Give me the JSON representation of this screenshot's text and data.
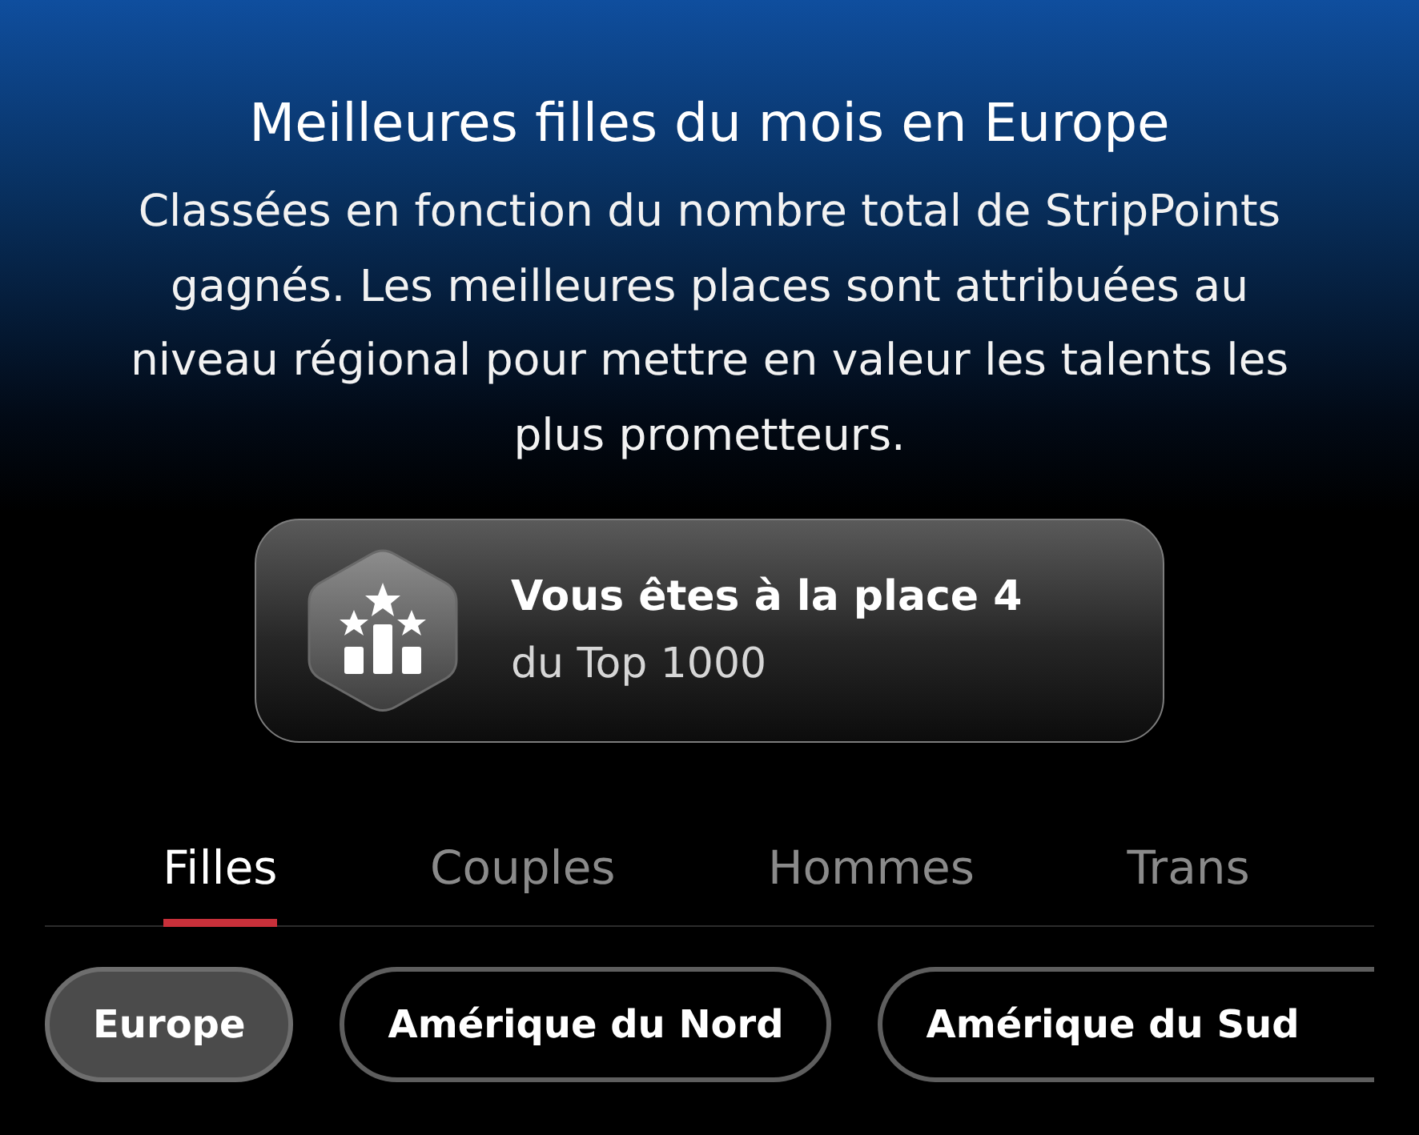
{
  "header": {
    "title": "Meilleures filles du mois en Europe",
    "description": "Classées en fonction du nombre total de StripPoints gagnés. Les meilleures places sont attribuées au niveau régional pour mettre en valeur les talents les plus prometteurs."
  },
  "rank_card": {
    "title": "Vous êtes à la place 4",
    "subtitle": "du Top 1000"
  },
  "tabs": [
    {
      "label": "Filles",
      "selected": true
    },
    {
      "label": "Couples",
      "selected": false
    },
    {
      "label": "Hommes",
      "selected": false
    },
    {
      "label": "Trans",
      "selected": false
    }
  ],
  "regions": [
    {
      "label": "Europe",
      "selected": true
    },
    {
      "label": "Amérique du Nord",
      "selected": false
    },
    {
      "label": "Amérique du Sud",
      "selected": false
    }
  ]
}
